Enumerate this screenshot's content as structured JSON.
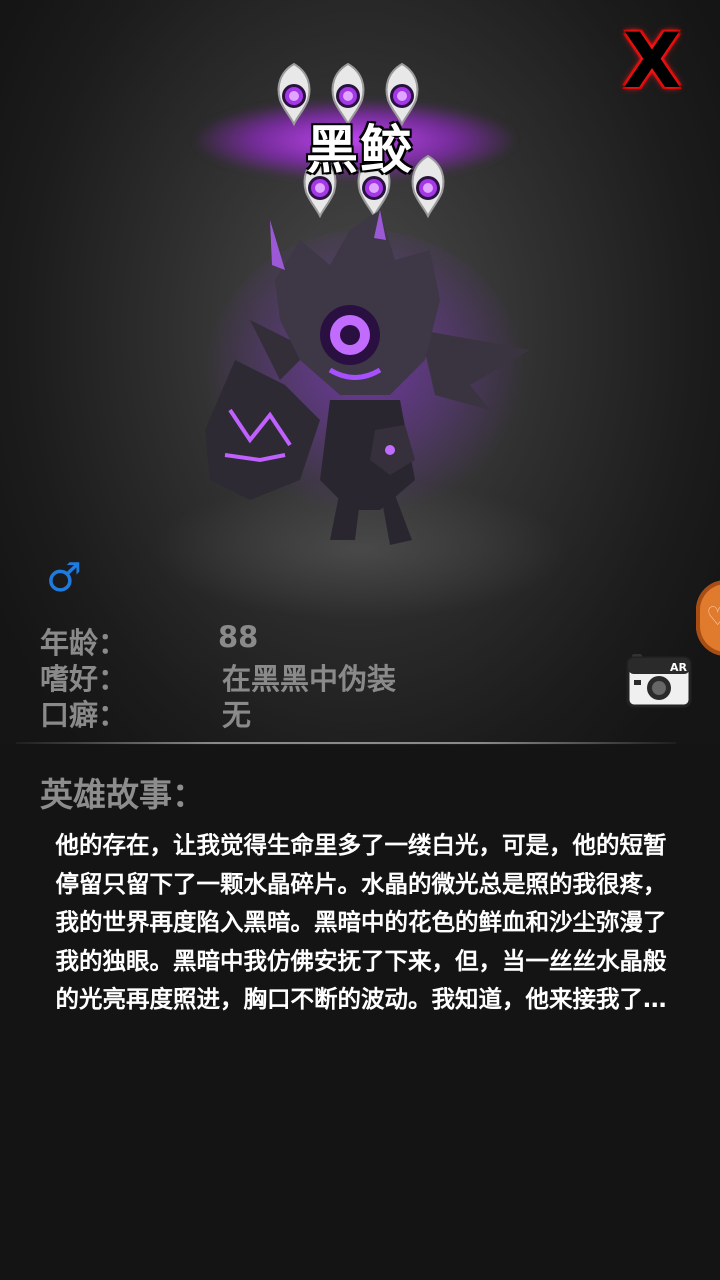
{
  "hero": {
    "name": "黑鲛",
    "gender_symbol": "♂",
    "star_count": 6
  },
  "close_button": {
    "label": "X"
  },
  "info": {
    "age": {
      "label": "年龄：",
      "value": "88"
    },
    "hobby": {
      "label": "嗜好：",
      "value": "在黑黑中伪装"
    },
    "catchphrase": {
      "label": "口癖：",
      "value": "无"
    }
  },
  "ar_button": {
    "label": "AR",
    "icon": "camera-icon"
  },
  "side_button": {
    "icon": "heart-icon"
  },
  "story": {
    "heading": "英雄故事：",
    "text": "他的存在，让我觉得生命里多了一缕白光，可是，他的短暂停留只留下了一颗水晶碎片。水晶的微光总是照的我很疼，我的世界再度陷入黑暗。黑暗中的花色的鲜血和沙尘弥漫了我的独眼。黑暗中我仿佛安抚了下来，但，当一丝丝水晶般的光亮再度照进，胸口不断的波动。我知道，他来接我了…"
  },
  "colors": {
    "accent_purple": "#b54bff",
    "close_red": "#ff1e1e",
    "gender_blue": "#1e7be0",
    "label_gray": "#8a8a8a",
    "side_orange": "#e07a2c"
  }
}
